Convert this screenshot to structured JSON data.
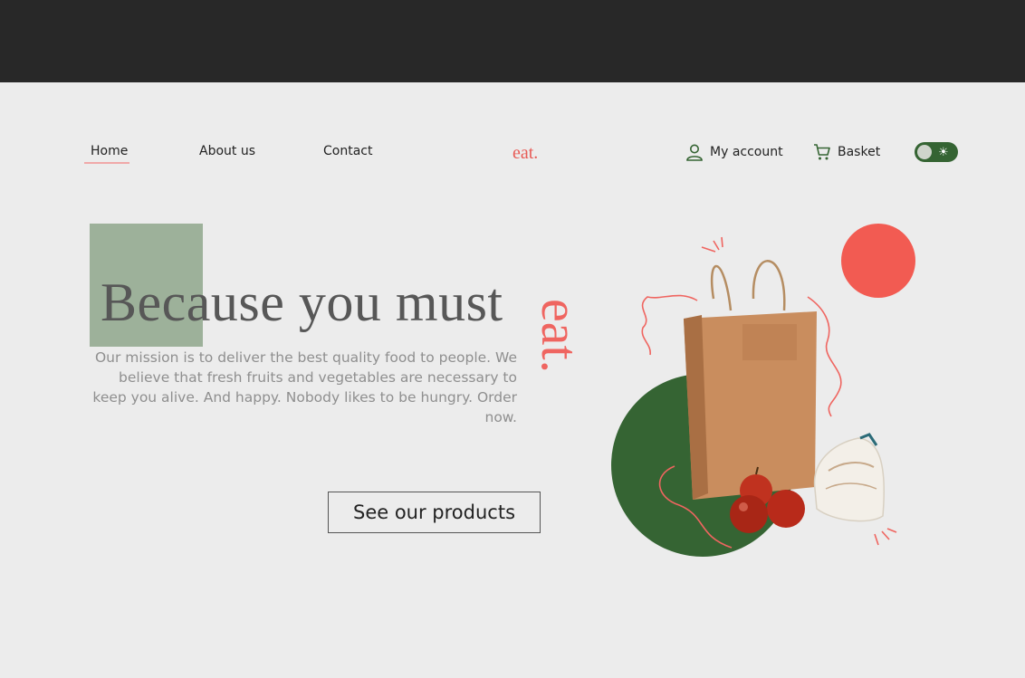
{
  "nav": {
    "home": "Home",
    "about": "About us",
    "contact": "Contact",
    "logo": "eat.",
    "account": "My account",
    "basket": "Basket"
  },
  "hero": {
    "headline": "Because you must",
    "headline_accent": "eat.",
    "mission": "Our mission is to deliver the best quality food to people. We believe that fresh fruits and vegetables are necessary to keep you alive. And happy. Nobody likes to be hungry. Order now.",
    "cta": "See our products"
  },
  "colors": {
    "accent_red": "#ef6560",
    "brand_green": "#356433",
    "sage": "#9db19a",
    "background": "#ececec",
    "top_bar": "#282828"
  },
  "icons": [
    "user-icon",
    "cart-icon",
    "sun-icon"
  ],
  "theme_toggle": {
    "state": "light"
  }
}
